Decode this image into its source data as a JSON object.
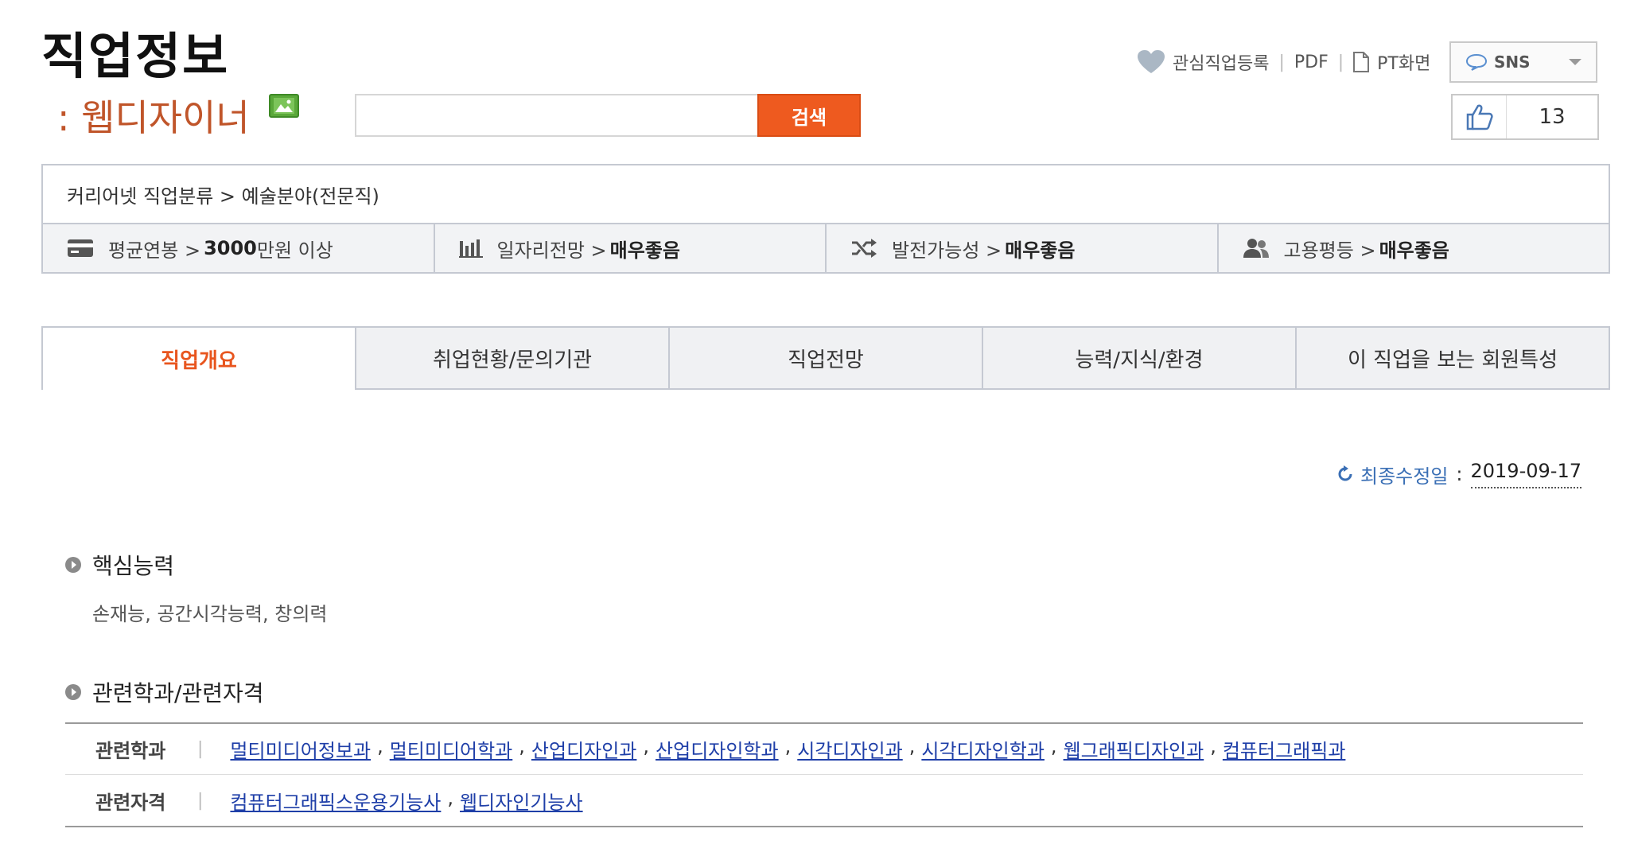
{
  "header": {
    "title": "직업정보",
    "job_name": ": 웹디자이너",
    "image_icon": "image-icon"
  },
  "search": {
    "placeholder": "",
    "button_label": "검색"
  },
  "tools": {
    "favorite_label": "관심직업등록",
    "pdf_label": "PDF",
    "pt_label": "PT화면",
    "sns_label": "SNS",
    "like_count": "13"
  },
  "info": {
    "classification": "커리어넷 직업분류 > 예술분야(전문직)",
    "stats": [
      {
        "icon": "card-icon",
        "label": "평균연봉 > ",
        "value": "3000",
        "suffix": " 만원 이상"
      },
      {
        "icon": "bar-chart-icon",
        "label": "일자리전망 > ",
        "value": "매우좋음",
        "suffix": ""
      },
      {
        "icon": "shuffle-icon",
        "label": "발전가능성 > ",
        "value": "매우좋음",
        "suffix": ""
      },
      {
        "icon": "people-icon",
        "label": "고용평등 > ",
        "value": "매우좋음",
        "suffix": ""
      }
    ]
  },
  "tabs": [
    "직업개요",
    "취업현황/문의기관",
    "직업전망",
    "능력/지식/환경",
    "이 직업을 보는 회원특성"
  ],
  "updated": {
    "label": "최종수정일",
    "colon": ":",
    "date": "2019-09-17"
  },
  "sections": {
    "core_title": "핵심능력",
    "core_body": "손재능, 공간시각능력, 창의력",
    "related_title": "관련학과/관련자격"
  },
  "related": {
    "majors_label": "관련학과",
    "majors": [
      "멀티미디어정보과",
      "멀티미디어학과",
      "산업디자인과",
      "산업디자인학과",
      "시각디자인과",
      "시각디자인학과",
      "웹그래픽디자인과",
      "컴퓨터그래픽과"
    ],
    "certs_label": "관련자격",
    "certs": [
      "컴퓨터그래픽스운용기능사",
      "웹디자인기능사"
    ],
    "divider": "|"
  },
  "colors": {
    "accent": "#e8551e",
    "job_name": "#c0552a",
    "link": "#1f3fa8",
    "search_button": "#ee5a1f"
  }
}
